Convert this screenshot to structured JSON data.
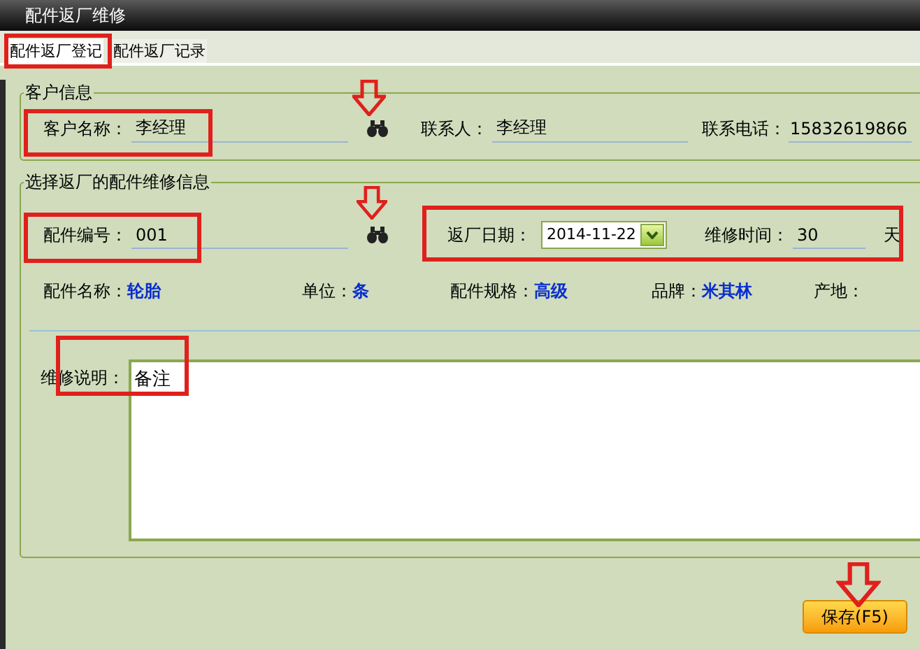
{
  "window": {
    "title": "配件返厂维修"
  },
  "tabs": [
    {
      "label": "配件返厂登记",
      "selected": true,
      "highlighted": true
    },
    {
      "label": "配件返厂记录",
      "selected": false,
      "highlighted": false
    }
  ],
  "customer": {
    "title": "客户信息",
    "lookup_arrow": true,
    "name": {
      "label": "客户名称：",
      "value": "李经理",
      "highlighted": true
    },
    "contact": {
      "label": "联系人：",
      "value": "李经理"
    },
    "phone": {
      "label": "联系电话：",
      "value": "15832619866"
    }
  },
  "part": {
    "title": "选择返厂的配件维修信息",
    "lookup_arrow": true,
    "schedule_highlighted": true,
    "part_no": {
      "label": "配件编号：",
      "value": "001",
      "highlighted": true
    },
    "return_date": {
      "label": "返厂日期：",
      "value": "2014-11-22"
    },
    "repair_time": {
      "label": "维修时间：",
      "value": "30",
      "unit": "天"
    },
    "details": [
      {
        "label": "配件名称：",
        "value": "轮胎"
      },
      {
        "label": "单位：",
        "value": "条"
      },
      {
        "label": "配件规格：",
        "value": "高级"
      },
      {
        "label": "品牌：",
        "value": "米其林"
      },
      {
        "label": "产地："
      }
    ],
    "note": {
      "label": "维修说明：",
      "value": "备注",
      "highlighted": true
    }
  },
  "save_button": {
    "label": "保存(F5)",
    "arrow": true
  }
}
